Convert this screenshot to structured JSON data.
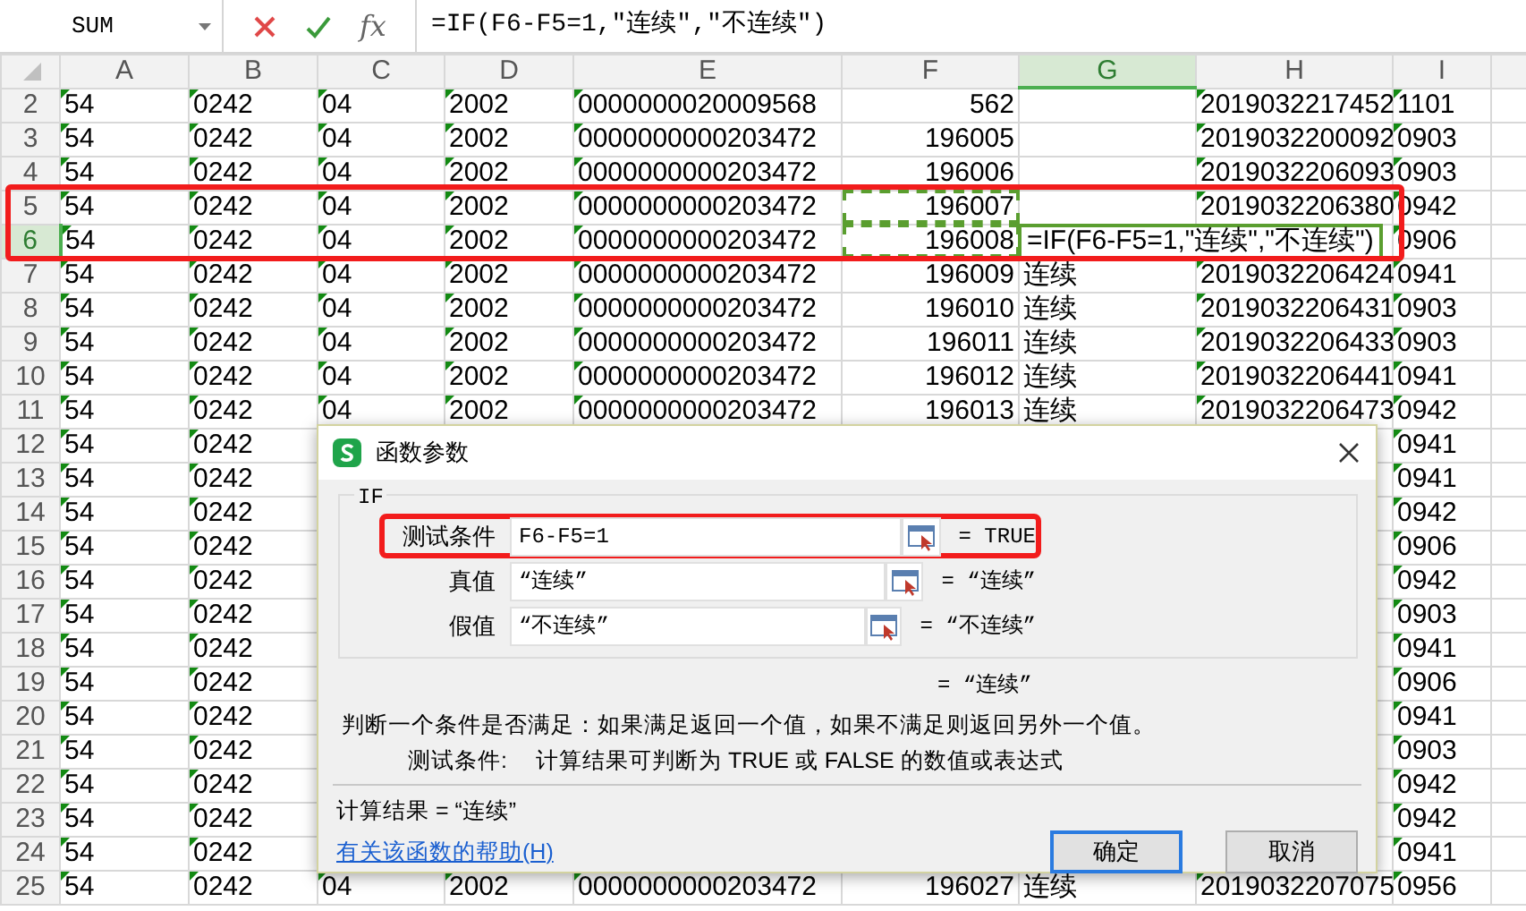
{
  "formula_bar": {
    "name_box": "SUM",
    "fx": "fx",
    "formula": "=IF(F6-F5=1,\"连续\",\"不连续\")"
  },
  "columns": [
    {
      "label": "A",
      "selected": false,
      "flag": true,
      "numeric": false
    },
    {
      "label": "B",
      "selected": false,
      "flag": true,
      "numeric": false
    },
    {
      "label": "C",
      "selected": false,
      "flag": true,
      "numeric": false
    },
    {
      "label": "D",
      "selected": false,
      "flag": true,
      "numeric": false
    },
    {
      "label": "E",
      "selected": false,
      "flag": true,
      "numeric": false
    },
    {
      "label": "F",
      "selected": false,
      "flag": false,
      "numeric": true
    },
    {
      "label": "G",
      "selected": true,
      "flag": false,
      "numeric": false
    },
    {
      "label": "H",
      "selected": false,
      "flag": true,
      "numeric": false
    },
    {
      "label": "I",
      "selected": false,
      "flag": true,
      "numeric": false
    }
  ],
  "rows": [
    {
      "number": "2",
      "selected": false,
      "framed": false,
      "cells": [
        "54",
        "0242",
        "04",
        "2002",
        "0000000020009568",
        "562",
        null,
        "2019032217452",
        "1101"
      ]
    },
    {
      "number": "3",
      "selected": false,
      "framed": false,
      "cells": [
        "54",
        "0242",
        "04",
        "2002",
        "0000000000203472",
        "196005",
        null,
        "2019032200092",
        "0903"
      ]
    },
    {
      "number": "4",
      "selected": false,
      "framed": false,
      "cells": [
        "54",
        "0242",
        "04",
        "2002",
        "0000000000203472",
        "196006",
        null,
        "2019032206093",
        "0903"
      ]
    },
    {
      "number": "5",
      "selected": false,
      "framed": true,
      "cells": [
        "54",
        "0242",
        "04",
        "2002",
        "0000000000203472",
        {
          "text": "196007",
          "marked": true
        },
        null,
        "2019032206380",
        "0942"
      ]
    },
    {
      "number": "6",
      "selected": true,
      "framed": true,
      "cells": [
        "54",
        "0242",
        "04",
        "2002",
        "0000000000203472",
        {
          "text": "196008",
          "marked": true
        },
        "=IF(F6-F5=1,\"连续\",\"不连续\")",
        null,
        "0906"
      ]
    },
    {
      "number": "7",
      "selected": false,
      "framed": false,
      "cells": [
        "54",
        "0242",
        "04",
        "2002",
        "0000000000203472",
        "196009",
        "连续",
        "2019032206424",
        "0941"
      ]
    },
    {
      "number": "8",
      "selected": false,
      "framed": false,
      "cells": [
        "54",
        "0242",
        "04",
        "2002",
        "0000000000203472",
        "196010",
        "连续",
        "2019032206431",
        "0903"
      ]
    },
    {
      "number": "9",
      "selected": false,
      "framed": false,
      "cells": [
        "54",
        "0242",
        "04",
        "2002",
        "0000000000203472",
        "196011",
        "连续",
        "2019032206433",
        "0903"
      ]
    },
    {
      "number": "10",
      "selected": false,
      "framed": false,
      "cells": [
        "54",
        "0242",
        "04",
        "2002",
        "0000000000203472",
        "196012",
        "连续",
        "2019032206441",
        "0941"
      ]
    },
    {
      "number": "11",
      "selected": false,
      "framed": false,
      "cells": [
        "54",
        "0242",
        "04",
        "2002",
        "0000000000203472",
        "196013",
        "连续",
        "2019032206473",
        "0942"
      ]
    },
    {
      "number": "12",
      "selected": false,
      "framed": false,
      "cells": [
        "54",
        "0242",
        null,
        null,
        null,
        null,
        null,
        null,
        "0941"
      ]
    },
    {
      "number": "13",
      "selected": false,
      "framed": false,
      "cells": [
        "54",
        "0242",
        null,
        null,
        null,
        null,
        null,
        null,
        "0941"
      ]
    },
    {
      "number": "14",
      "selected": false,
      "framed": false,
      "cells": [
        "54",
        "0242",
        null,
        null,
        null,
        null,
        null,
        null,
        "0942"
      ]
    },
    {
      "number": "15",
      "selected": false,
      "framed": false,
      "cells": [
        "54",
        "0242",
        null,
        null,
        null,
        null,
        null,
        null,
        "0906"
      ]
    },
    {
      "number": "16",
      "selected": false,
      "framed": false,
      "cells": [
        "54",
        "0242",
        null,
        null,
        null,
        null,
        null,
        null,
        "0942"
      ]
    },
    {
      "number": "17",
      "selected": false,
      "framed": false,
      "cells": [
        "54",
        "0242",
        null,
        null,
        null,
        null,
        null,
        null,
        "0903"
      ]
    },
    {
      "number": "18",
      "selected": false,
      "framed": false,
      "cells": [
        "54",
        "0242",
        null,
        null,
        null,
        null,
        null,
        null,
        "0941"
      ]
    },
    {
      "number": "19",
      "selected": false,
      "framed": false,
      "cells": [
        "54",
        "0242",
        null,
        null,
        null,
        null,
        null,
        null,
        "0906"
      ]
    },
    {
      "number": "20",
      "selected": false,
      "framed": false,
      "cells": [
        "54",
        "0242",
        null,
        null,
        null,
        null,
        null,
        null,
        "0941"
      ]
    },
    {
      "number": "21",
      "selected": false,
      "framed": false,
      "cells": [
        "54",
        "0242",
        null,
        null,
        null,
        null,
        null,
        null,
        "0903"
      ]
    },
    {
      "number": "22",
      "selected": false,
      "framed": false,
      "cells": [
        "54",
        "0242",
        null,
        null,
        null,
        null,
        null,
        null,
        "0942"
      ]
    },
    {
      "number": "23",
      "selected": false,
      "framed": false,
      "cells": [
        "54",
        "0242",
        null,
        null,
        null,
        null,
        null,
        null,
        "0942"
      ]
    },
    {
      "number": "24",
      "selected": false,
      "framed": false,
      "cells": [
        "54",
        "0242",
        null,
        null,
        null,
        null,
        null,
        null,
        "0941"
      ]
    },
    {
      "number": "25",
      "selected": false,
      "framed": false,
      "cells": [
        "54",
        "0242",
        "04",
        "2002",
        "0000000000203472",
        "196027",
        "连续",
        "2019032207075",
        "0956"
      ]
    }
  ],
  "dialog": {
    "title": "函数参数",
    "function": "IF",
    "args": [
      {
        "label": "测试条件",
        "value": "F6-F5=1",
        "result": "= TRUE",
        "framed": true
      },
      {
        "label": "真值",
        "value": "“连续”",
        "result": "= “连续”",
        "framed": false
      },
      {
        "label": "假值",
        "value": "“不连续”",
        "result": "= “不连续”",
        "framed": false
      }
    ],
    "result": "= “连续”",
    "description": "判断一个条件是否满足：如果满足返回一个值，如果不满足则返回另外一个值。",
    "arg_help_label": "测试条件:",
    "arg_help": "计算结果可判断为 TRUE 或 FALSE 的数值或表达式",
    "calc_result": "计算结果 = “连续”",
    "help_link": "有关该函数的帮助(H)",
    "buttons": [
      {
        "label": "确定",
        "primary": true
      },
      {
        "label": "取消",
        "primary": false
      }
    ]
  }
}
